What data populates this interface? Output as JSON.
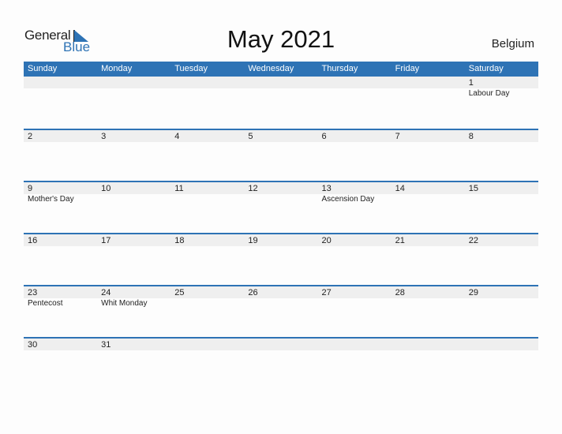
{
  "logo": {
    "word1": "General",
    "word2": "Blue"
  },
  "title": "May 2021",
  "country": "Belgium",
  "weekdays": [
    "Sunday",
    "Monday",
    "Tuesday",
    "Wednesday",
    "Thursday",
    "Friday",
    "Saturday"
  ],
  "weeks": [
    {
      "days": [
        "",
        "",
        "",
        "",
        "",
        "",
        "1"
      ],
      "events": [
        "",
        "",
        "",
        "",
        "",
        "",
        "Labour Day"
      ]
    },
    {
      "days": [
        "2",
        "3",
        "4",
        "5",
        "6",
        "7",
        "8"
      ],
      "events": [
        "",
        "",
        "",
        "",
        "",
        "",
        ""
      ]
    },
    {
      "days": [
        "9",
        "10",
        "11",
        "12",
        "13",
        "14",
        "15"
      ],
      "events": [
        "Mother's Day",
        "",
        "",
        "",
        "Ascension Day",
        "",
        ""
      ]
    },
    {
      "days": [
        "16",
        "17",
        "18",
        "19",
        "20",
        "21",
        "22"
      ],
      "events": [
        "",
        "",
        "",
        "",
        "",
        "",
        ""
      ]
    },
    {
      "days": [
        "23",
        "24",
        "25",
        "26",
        "27",
        "28",
        "29"
      ],
      "events": [
        "Pentecost",
        "Whit Monday",
        "",
        "",
        "",
        "",
        ""
      ]
    },
    {
      "days": [
        "30",
        "31",
        "",
        "",
        "",
        "",
        ""
      ],
      "events": [
        "",
        "",
        "",
        "",
        "",
        "",
        ""
      ]
    }
  ],
  "colors": {
    "accent": "#2e73b5",
    "strip": "#efefef"
  }
}
